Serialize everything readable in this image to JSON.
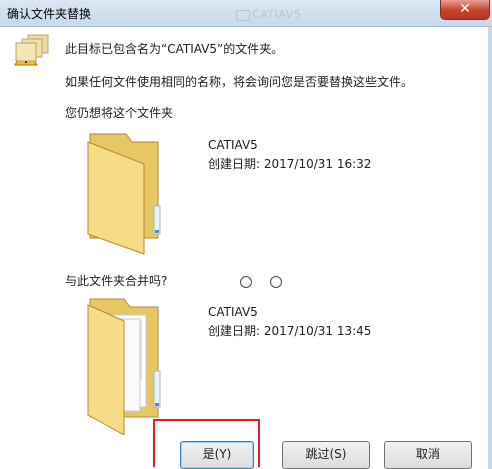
{
  "window": {
    "title": "确认文件夹替换",
    "background_window_title": "CATIAV5",
    "close_symbol": "✕"
  },
  "message": {
    "heading": "此目标已包含名为“CATIAV5”的文件夹。",
    "question": "如果任何文件使用相同的名称，将会询问您是否要替换这些文件。",
    "prompt": "您仍想将这个文件夹"
  },
  "target_folder": {
    "name": "CATIAV5",
    "created": "创建日期: 2017/10/31 16:32",
    "icon": "empty-folder-icon"
  },
  "merge_prompt": "与此文件夹合并吗?",
  "source_folder": {
    "name": "CATIAV5",
    "created": "创建日期: 2017/10/31 13:45",
    "icon": "full-folder-icon"
  },
  "buttons": {
    "yes": "是(Y)",
    "skip": "跳过(S)",
    "cancel": "取消"
  },
  "colors": {
    "highlight": "#e02020",
    "folder": "#f2d37c"
  }
}
